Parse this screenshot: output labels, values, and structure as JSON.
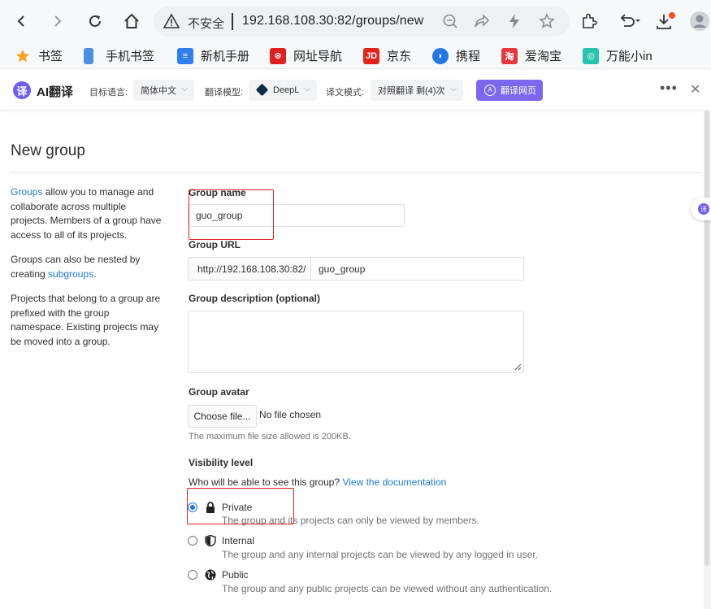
{
  "browser": {
    "insecure_label": "不安全",
    "url": "192.168.108.30:82/groups/new"
  },
  "bookmarks": [
    {
      "label": "书签",
      "icon": "star-icon",
      "color": "#f5a623"
    },
    {
      "label": "手机书签",
      "icon": "phone-icon",
      "color": "#4a90e2"
    },
    {
      "label": "新机手册",
      "icon": "manual-icon",
      "color": "#2f80ed"
    },
    {
      "label": "网址导航",
      "icon": "nav-icon",
      "color": "#e02020"
    },
    {
      "label": "京东",
      "icon": "jd-icon",
      "color": "#e1251b"
    },
    {
      "label": "携程",
      "icon": "ctrip-icon",
      "color": "#2577e3"
    },
    {
      "label": "爱淘宝",
      "icon": "taobao-icon",
      "color": "#e4393c"
    },
    {
      "label": "万能小in",
      "icon": "in-icon",
      "color": "#27c2b0"
    }
  ],
  "translate_bar": {
    "logo_char": "译",
    "title": "AI翻译",
    "target_lang_label": "目标语言:",
    "target_lang": "简体中文",
    "model_label": "翻译模型:",
    "model": "DeepL",
    "mode_label": "译文模式:",
    "mode": "对照翻译 剩(4)次",
    "translate_button": "翻译网页",
    "accent": "#7b68ee"
  },
  "page": {
    "title": "New group",
    "side_text": {
      "p1_link": "Groups",
      "p1_rest": " allow you to manage and collaborate across multiple projects. Members of a group have access to all of its projects.",
      "p2_start": "Groups can also be nested by creating ",
      "p2_link": "subgroups",
      "p2_end": ".",
      "p3": "Projects that belong to a group are prefixed with the group namespace. Existing projects may be moved into a group."
    },
    "form": {
      "group_name_label": "Group name",
      "group_name_value": "guo_group",
      "group_url_label": "Group URL",
      "group_url_prefix": "http://192.168.108.30:82/",
      "group_url_value": "guo_group",
      "description_label": "Group description (optional)",
      "avatar_label": "Group avatar",
      "choose_file_button": "Choose file...",
      "file_status": "No file chosen",
      "avatar_help": "The maximum file size allowed is 200KB.",
      "visibility_label": "Visibility level",
      "visibility_question": "Who will be able to see this group?",
      "visibility_doc_link": "View the documentation",
      "visibility_options": [
        {
          "title": "Private",
          "desc": "The group and its projects can only be viewed by members.",
          "checked": true,
          "icon": "lock-icon"
        },
        {
          "title": "Internal",
          "desc": "The group and any internal projects can be viewed by any logged in user.",
          "checked": false,
          "icon": "shield-icon"
        },
        {
          "title": "Public",
          "desc": "The group and any public projects can be viewed without any authentication.",
          "checked": false,
          "icon": "globe-icon"
        }
      ]
    }
  }
}
